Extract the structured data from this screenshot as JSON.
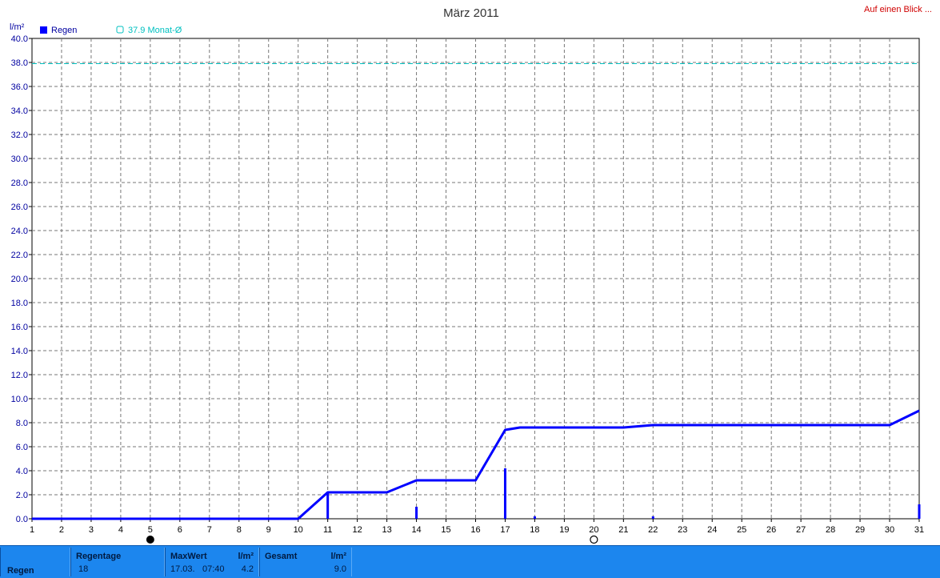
{
  "link_label": "Auf einen Blick ...",
  "chart_data": {
    "type": "line",
    "title": "März 2011",
    "ylabel": "l/m²",
    "ylim": [
      0,
      40
    ],
    "yticks": [
      "0.0",
      "2.0",
      "4.0",
      "6.0",
      "8.0",
      "10.0",
      "12.0",
      "14.0",
      "16.0",
      "18.0",
      "20.0",
      "22.0",
      "24.0",
      "26.0",
      "28.0",
      "30.0",
      "32.0",
      "34.0",
      "36.0",
      "38.0",
      "40.0"
    ],
    "xlim": [
      1,
      31
    ],
    "xticks": [
      "1",
      "2",
      "3",
      "4",
      "5",
      "6",
      "7",
      "8",
      "9",
      "10",
      "11",
      "12",
      "13",
      "14",
      "15",
      "16",
      "17",
      "18",
      "19",
      "20",
      "21",
      "22",
      "23",
      "24",
      "25",
      "26",
      "27",
      "28",
      "29",
      "30",
      "31"
    ],
    "grid": true,
    "legend": [
      "Regen",
      "37.9 Monat-Ø"
    ],
    "series": [
      {
        "name": "Regen",
        "kind": "cumulative-line",
        "color": "#0000ff",
        "x": [
          1,
          10,
          11,
          13,
          14,
          16,
          17,
          17.5,
          21,
          22,
          30,
          31
        ],
        "y": [
          0,
          0,
          2.2,
          2.2,
          3.2,
          3.2,
          7.4,
          7.6,
          7.6,
          7.8,
          7.8,
          9.0
        ]
      },
      {
        "name": "Regen",
        "kind": "daily-bars",
        "color": "#0000ff",
        "x": [
          11,
          14,
          17,
          18,
          22,
          31
        ],
        "y": [
          2.2,
          1.0,
          4.2,
          0.2,
          0.2,
          1.2
        ]
      },
      {
        "name": "37.9 Monat-Ø",
        "kind": "reference-line",
        "color": "#00c0c0",
        "value": 37.9
      }
    ],
    "moon_phases": [
      {
        "day": 5,
        "phase": "new-moon"
      },
      {
        "day": 20,
        "phase": "full-moon"
      }
    ]
  },
  "footer": {
    "row_label": "Regen",
    "regentage_label": "Regentage",
    "regentage_value": "18",
    "maxwert_label": "MaxWert",
    "maxwert_unit": "l/m²",
    "maxwert_date": "17.03.",
    "maxwert_time": "07:40",
    "maxwert_value": "4.2",
    "gesamt_label": "Gesamt",
    "gesamt_unit": "l/m²",
    "gesamt_value": "9.0"
  },
  "colors": {
    "axis_text": "#0000a0",
    "footer_bg": "#1c86ee",
    "link": "#d00000"
  }
}
